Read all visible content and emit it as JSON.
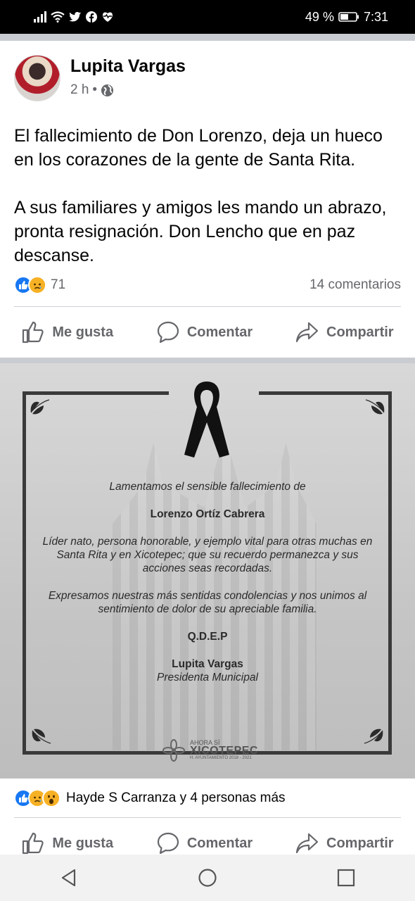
{
  "status_bar": {
    "battery": "49 %",
    "time": "7:31"
  },
  "post": {
    "author": "Lupita Vargas",
    "time_ago": "2 h",
    "separator": "•",
    "privacy_icon": "globe-icon",
    "paragraphs": [
      "El fallecimiento de Don Lorenzo, deja un hueco en los corazones de la gente de Santa Rita.",
      "A sus familiares y amigos les mando un abrazo, pronta resignación. Don Lencho que en paz descanse."
    ],
    "reactions_count": "71",
    "comments_count": "14 comentarios",
    "actions": {
      "like": "Me gusta",
      "comment": "Comentar",
      "share": "Compartir"
    }
  },
  "shared_image": {
    "line1": "Lamentamos el sensible fallecimiento de",
    "name": "Lorenzo Ortíz Cabrera",
    "tribute": "Líder nato, persona honorable, y ejemplo vital para otras muchas en Santa Rita y en Xicotepec; que su recuerdo permanezca y sus acciones seas recordadas.",
    "condolences": "Expresamos nuestras más sentidas condolencias y nos unimos al sentimiento de dolor de su apreciable familia.",
    "qdep": "Q.D.E.P",
    "signer_name": "Lupita Vargas",
    "signer_title": "Presidenta Municipal",
    "logo_top": "AHORA SÍ",
    "logo_main": "XICOTEPEC",
    "logo_sub": "H. AYUNTAMIENTO 2018 - 2021"
  },
  "image_reactions": {
    "text": "Hayde S Carranza y 4 personas más"
  },
  "colors": {
    "facebook_blue": "#1877f2",
    "reaction_yellow": "#f7b125",
    "secondary_text": "#65676b"
  }
}
